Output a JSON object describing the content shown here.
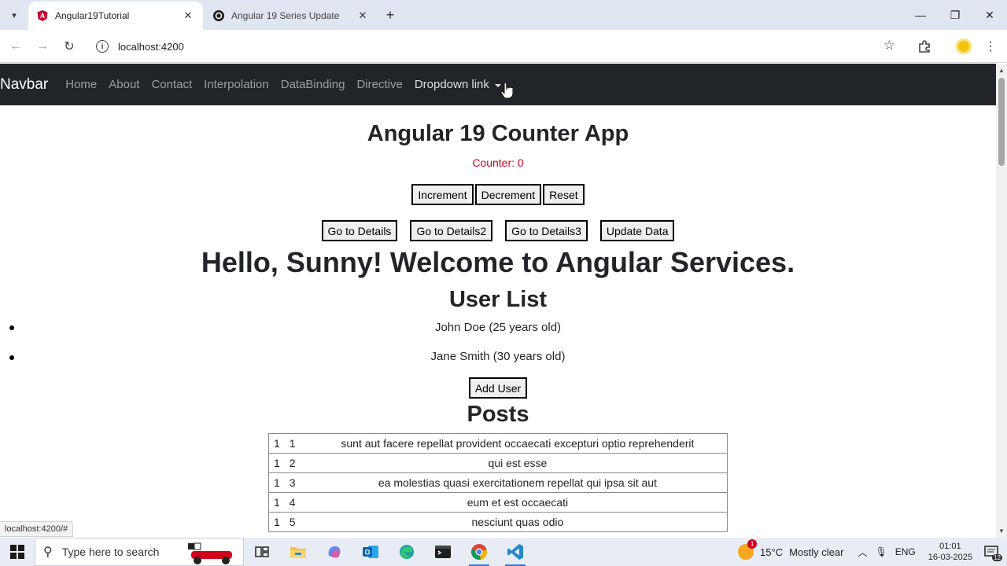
{
  "browser": {
    "tabs": [
      {
        "title": "Angular19Tutorial",
        "favicon": "angular-icon",
        "active": true
      },
      {
        "title": "Angular 19 Series Update",
        "favicon": "openai-icon",
        "active": false
      }
    ],
    "url": "localhost:4200",
    "status_url": "localhost:4200/#",
    "profile_color": "#f4c20d"
  },
  "navbar": {
    "brand": "Navbar",
    "links": [
      "Home",
      "About",
      "Contact",
      "Interpolation",
      "DataBinding",
      "Directive"
    ],
    "dropdown_label": "Dropdown link"
  },
  "counter_app": {
    "title": "Angular 19 Counter App",
    "counter_text": "Counter: 0",
    "buttons": [
      "Increment",
      "Decrement",
      "Reset"
    ],
    "nav_buttons": [
      "Go to Details",
      "Go to Details2",
      "Go to Details3",
      "Update Data"
    ]
  },
  "greeting": "Hello, Sunny! Welcome to Angular Services.",
  "user_list": {
    "title": "User List",
    "users": [
      "John Doe (25 years old)",
      "Jane Smith (30 years old)"
    ],
    "add_button": "Add User"
  },
  "posts": {
    "title": "Posts",
    "rows": [
      {
        "userId": "1",
        "id": "1",
        "title": "sunt aut facere repellat provident occaecati excepturi optio reprehenderit"
      },
      {
        "userId": "1",
        "id": "2",
        "title": "qui est esse"
      },
      {
        "userId": "1",
        "id": "3",
        "title": "ea molestias quasi exercitationem repellat qui ipsa sit aut"
      },
      {
        "userId": "1",
        "id": "4",
        "title": "eum et est occaecati"
      },
      {
        "userId": "1",
        "id": "5",
        "title": "nesciunt quas odio"
      }
    ]
  },
  "taskbar": {
    "search_placeholder": "Type here to search",
    "apps": [
      "task-view-icon",
      "file-explorer-icon",
      "copilot-icon",
      "outlook-icon",
      "edge-icon",
      "terminal-icon",
      "chrome-icon",
      "vscode-icon"
    ],
    "weather": {
      "temp": "15°C",
      "condition": "Mostly clear",
      "badge": "1"
    },
    "language": "ENG",
    "time": "01:01",
    "date": "16-03-2025",
    "notification_count": "12"
  },
  "colors": {
    "navbar_bg": "#212529",
    "counter_text": "#d0021b",
    "accent": "#3a7bd5"
  }
}
